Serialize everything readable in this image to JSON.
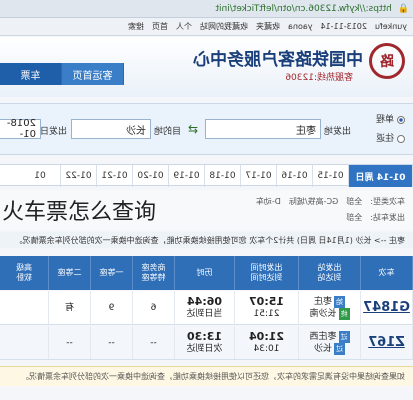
{
  "browser": {
    "url": "https://kyfw.12306.cn/otn/leftTicket/init",
    "secure_label": "https"
  },
  "bookmarks": [
    "yunkefu",
    "2013-11-14",
    "yaona",
    "收藏夹",
    "收藏我的网站",
    "个人",
    "首页",
    "搜索"
  ],
  "header": {
    "brand": "中国铁路客户服务中心",
    "sub": "客服热线:12306",
    "logo_glyph": "路",
    "nav": [
      "客运首页",
      "车票"
    ]
  },
  "search": {
    "trip_types": [
      "单程",
      "往返"
    ],
    "from_label": "出发地",
    "from_value": "枣庄",
    "to_label": "目的地",
    "to_value": "长沙",
    "date_label": "出发日",
    "date_value": "2018-01-"
  },
  "dates": [
    "01-14 周日",
    "01-15",
    "01-16",
    "01-17",
    "01-18",
    "01-19",
    "01-20",
    "01-21",
    "01-22",
    "01"
  ],
  "filters": {
    "type_label": "车次类型:",
    "types": [
      "全部",
      "GC-高铁/城际",
      "D-动车"
    ],
    "station_label": "出发车站:",
    "stations": [
      "全部"
    ]
  },
  "summary": "枣庄 --> 长沙 (1月14日 周日) 共计2个车次  您可使用接续换乘功能，查询途中换乘一次的部分列车余票情况。",
  "table": {
    "headers": [
      "车次",
      "出发站\n到达站",
      "出发时间\n到达时间",
      "历时",
      "商务座\n特等座",
      "一等座",
      "二等座",
      "高级\n软卧"
    ],
    "rows": [
      {
        "train": "G1847",
        "from": "枣庄",
        "to": "长沙南",
        "depart": "15:07",
        "arrive": "21:51",
        "duration": "06:44",
        "duration_note": "当日到达",
        "business": "6",
        "first": "9",
        "second": "有"
      },
      {
        "train": "Z167",
        "from": "枣庄西",
        "to": "长沙",
        "depart": "21:04",
        "arrive": "10:34",
        "duration": "13:30",
        "duration_note": "次日到达",
        "business": "--",
        "first": "--",
        "second": "--"
      }
    ]
  },
  "footnote": "如果查询结果中没有满足需求的车次，您还可以使用接续换乘功能，查询途中换乘一次的部分列车余票情况。",
  "caption": "火车票怎么查询"
}
